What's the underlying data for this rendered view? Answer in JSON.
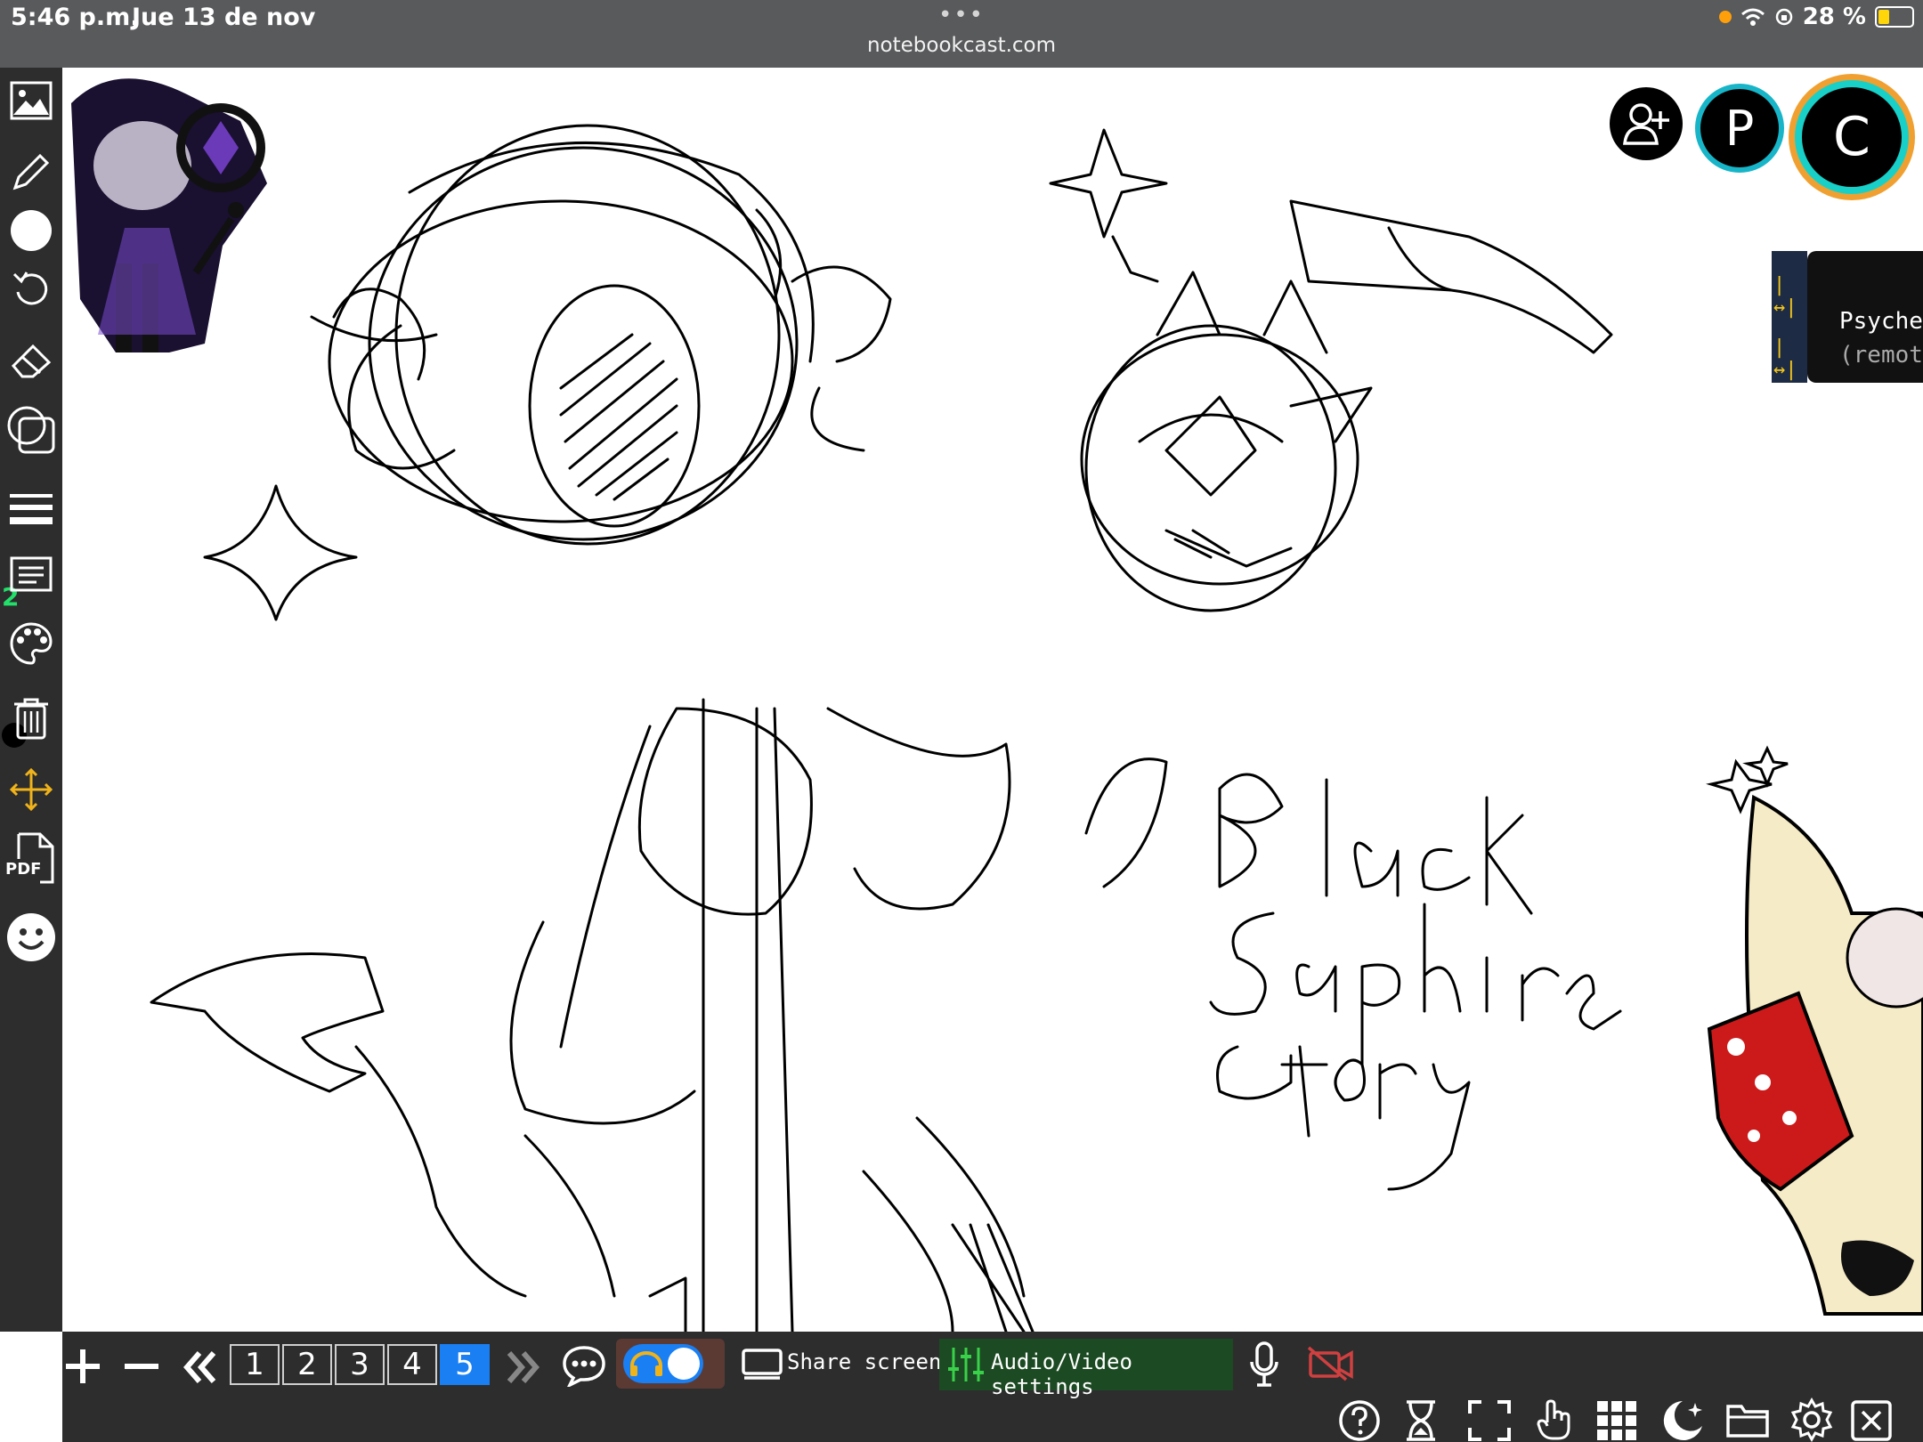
{
  "status_bar": {
    "time": "5:46 p.m.",
    "date": "Jue 13 de nov",
    "url": "notebookcast.com",
    "battery": "28 %"
  },
  "left_toolbar": {
    "tools": [
      "image-icon",
      "pencil-icon",
      "brush-size-icon",
      "undo-icon",
      "eraser-icon",
      "shapes-icon",
      "line-width-icon",
      "text-icon",
      "palette-icon",
      "trash-icon",
      "move-icon",
      "pdf-icon",
      "emoji-icon"
    ],
    "line_width_badge": "2",
    "pdf_label": "PDF"
  },
  "canvas": {
    "handwriting": [
      "Black",
      "Sapphire",
      "Story"
    ]
  },
  "bottom_bar": {
    "pages": [
      "1",
      "2",
      "3",
      "4",
      "5"
    ],
    "active_page": "5",
    "share_label": "Share screen",
    "av_settings_label": "Audio/Video settings",
    "colors": {
      "active_page": "#1a7ff2",
      "av_bg": "#1c4a22",
      "toggle_bg": "#5b3a33"
    }
  },
  "participants": {
    "avatars": [
      {
        "letter": "P",
        "ring": "#18b5c8"
      },
      {
        "letter": "C",
        "ring": "#f0a030"
      }
    ],
    "remote_name": "Psychecraft",
    "remote_status": "(remote)"
  }
}
